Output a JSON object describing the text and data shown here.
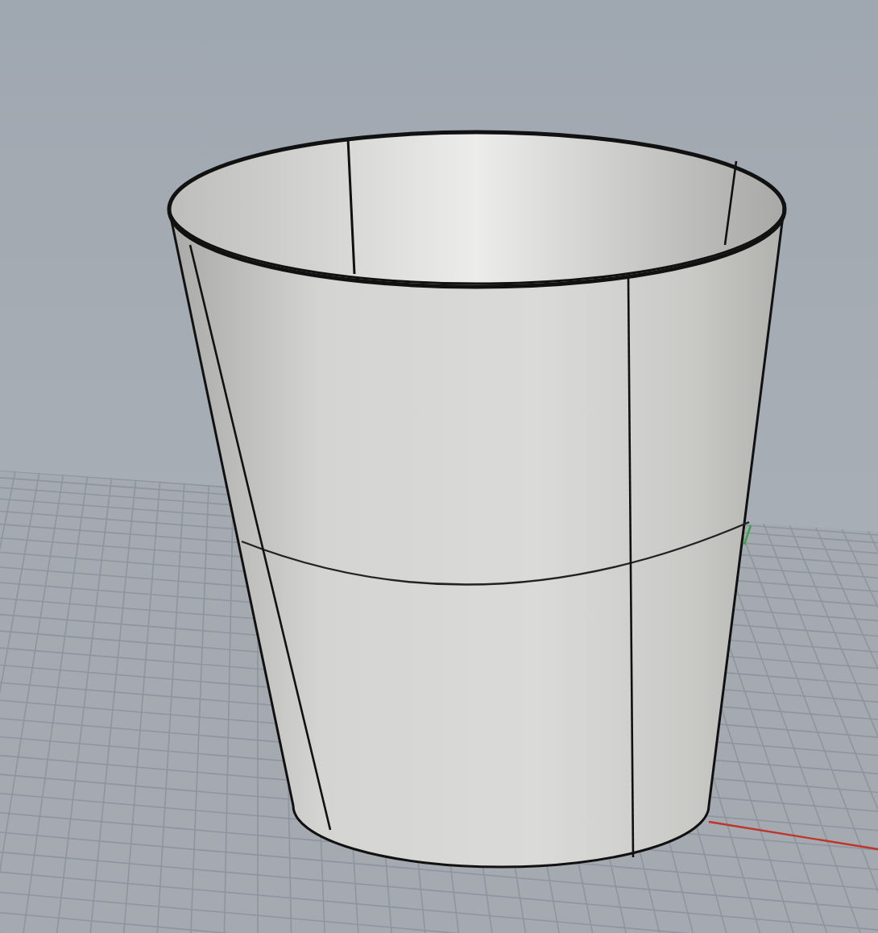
{
  "viewport": {
    "kind": "perspective",
    "show_grid": true,
    "show_axes": true
  }
}
